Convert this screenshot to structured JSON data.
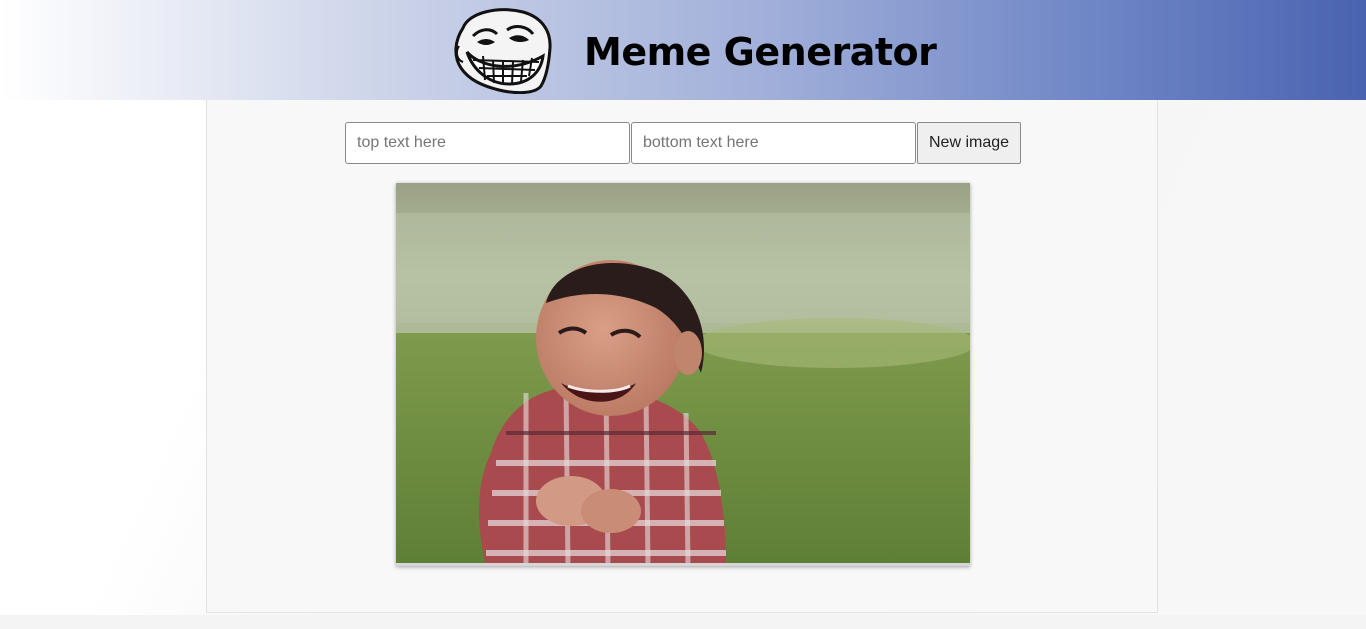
{
  "header": {
    "title": "Meme Generator",
    "logo_icon": "troll-face-icon",
    "gradient_colors": [
      "#ffffff",
      "#4a63b0"
    ]
  },
  "form": {
    "top_text": {
      "value": "",
      "placeholder": "top text here"
    },
    "bottom_text": {
      "value": "",
      "placeholder": "bottom text here"
    },
    "new_image_label": "New image"
  },
  "meme": {
    "top_caption": "",
    "bottom_caption": ""
  }
}
